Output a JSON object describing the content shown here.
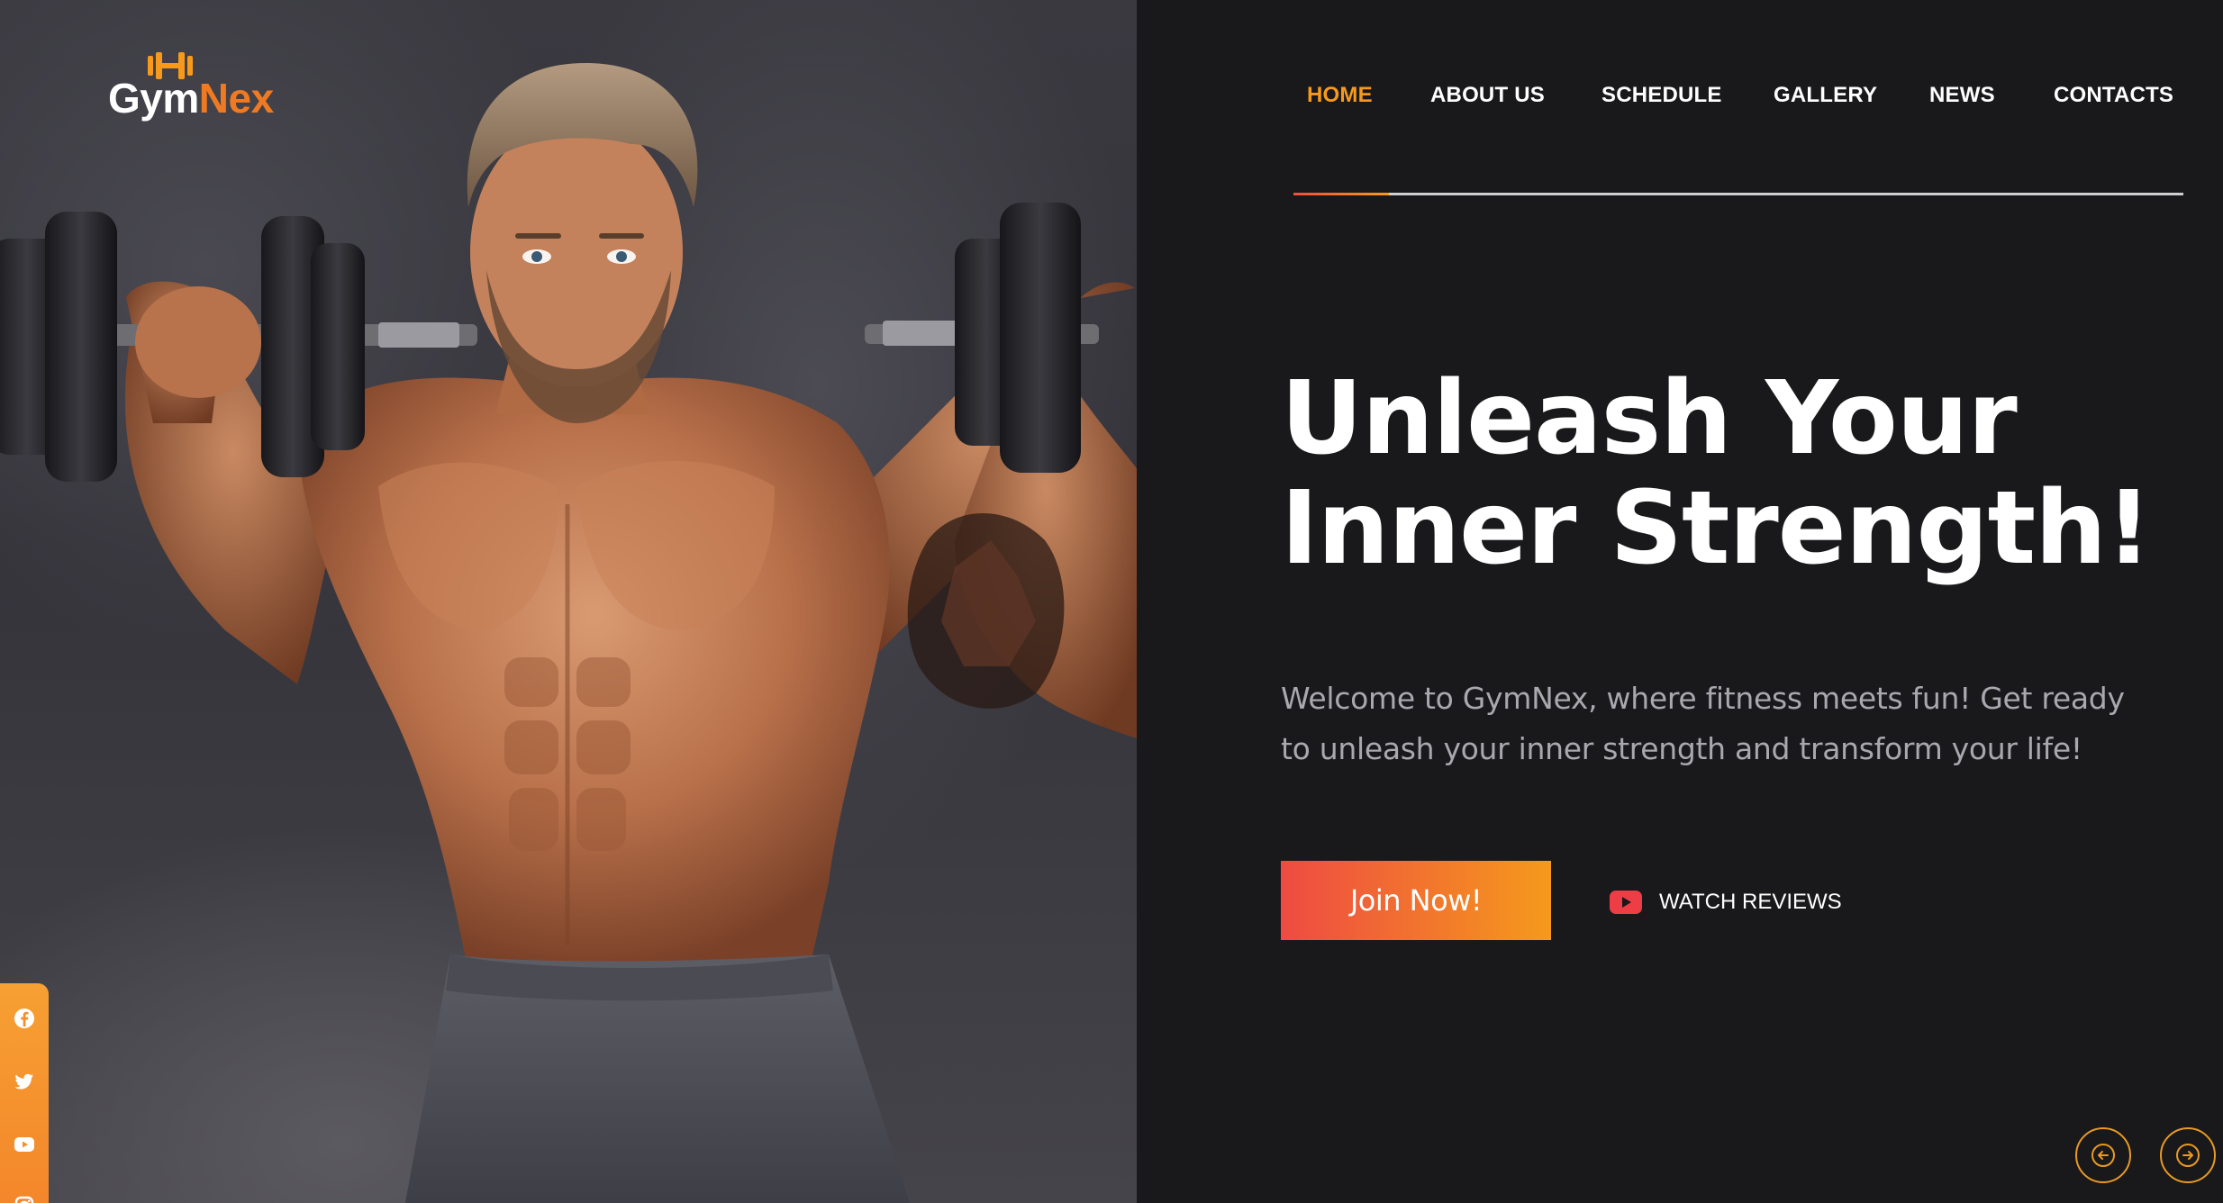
{
  "brand": {
    "name_part1": "Gym",
    "name_part2": "Nex",
    "accent": "#f07a22"
  },
  "nav": {
    "items": [
      {
        "label": "HOME",
        "active": true
      },
      {
        "label": "ABOUT US",
        "active": false
      },
      {
        "label": "SCHEDULE",
        "active": false
      },
      {
        "label": "GALLERY",
        "active": false
      },
      {
        "label": "NEWS",
        "active": false
      },
      {
        "label": "CONTACTS",
        "active": false
      }
    ],
    "active_color": "#f79a1c"
  },
  "hero": {
    "headline_line1": "Unleash Your",
    "headline_line2": "Inner Strength!",
    "subtitle": "Welcome to GymNex, where fitness meets fun! Get ready to unleash your inner strength and transform your life!",
    "primary_button": "Join Now!",
    "secondary_button": "WATCH REVIEWS",
    "secondary_icon": "youtube-play-icon",
    "button_gradient": [
      "#ee4b42",
      "#f59a1c"
    ]
  },
  "slider": {
    "prev_icon": "arrow-left-circle-icon",
    "next_icon": "arrow-right-circle-icon"
  },
  "social": {
    "items": [
      {
        "icon": "facebook-icon"
      },
      {
        "icon": "twitter-icon"
      },
      {
        "icon": "youtube-icon"
      },
      {
        "icon": "instagram-icon"
      }
    ],
    "bar_color": "#f7a033"
  },
  "colors": {
    "background": "#19181a",
    "text": "#ffffff",
    "muted": "#a9a8ae"
  }
}
